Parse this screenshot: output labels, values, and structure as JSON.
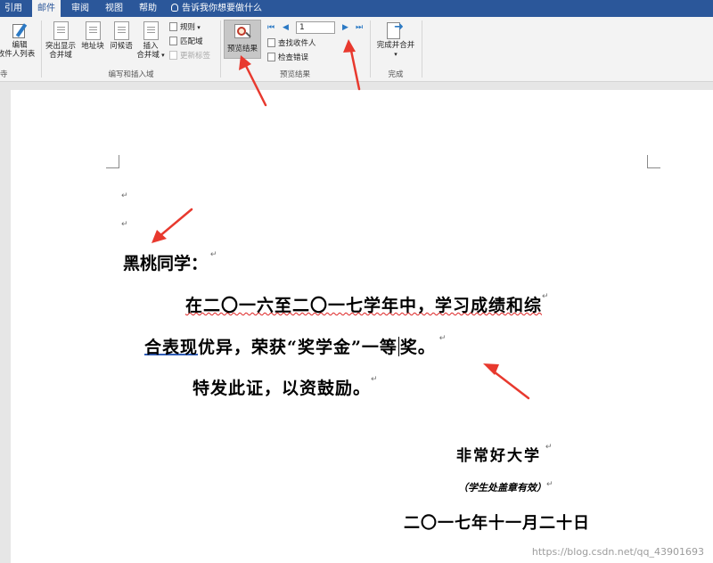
{
  "tabs": [
    "引用",
    "邮件",
    "审阅",
    "视图",
    "帮助"
  ],
  "tell_me": "告诉我你想要做什么",
  "ribbon": {
    "edit_recipients": [
      "编辑",
      "收件人列表"
    ],
    "highlight_merge": [
      "突出显示",
      "合并域"
    ],
    "address_block": "地址块",
    "greeting_line": "问候语",
    "insert_merge_field": [
      "插入",
      "合并域"
    ],
    "rules": "规则",
    "match_fields": "匹配域",
    "update_labels": "更新标签",
    "group_write_insert": "编写和插入域",
    "group_left_partial": "寺",
    "preview_results": "预览结果",
    "record_number": "1",
    "find_recipient": "查找收件人",
    "check_errors": "检查错误",
    "group_preview": "预览结果",
    "finish_merge": "完成并合并",
    "group_finish": "完成"
  },
  "document": {
    "salutation": "黑桃同学：",
    "line1": "在二〇一六至二〇一七学年中，学习成绩和综",
    "line2_a": "合表现",
    "line2_b": "优异，荣获“奖学金”一等",
    "line2_c": "奖。",
    "line3": "特发此证，以资鼓励。",
    "org": "非常好大学",
    "seal_note": "（学生处盖章有效）",
    "date": "二〇一七年十一月二十日"
  },
  "watermark": "https://blog.csdn.net/qq_43901693",
  "colors": {
    "accent": "#2b579a",
    "arrow": "#e8392e"
  }
}
